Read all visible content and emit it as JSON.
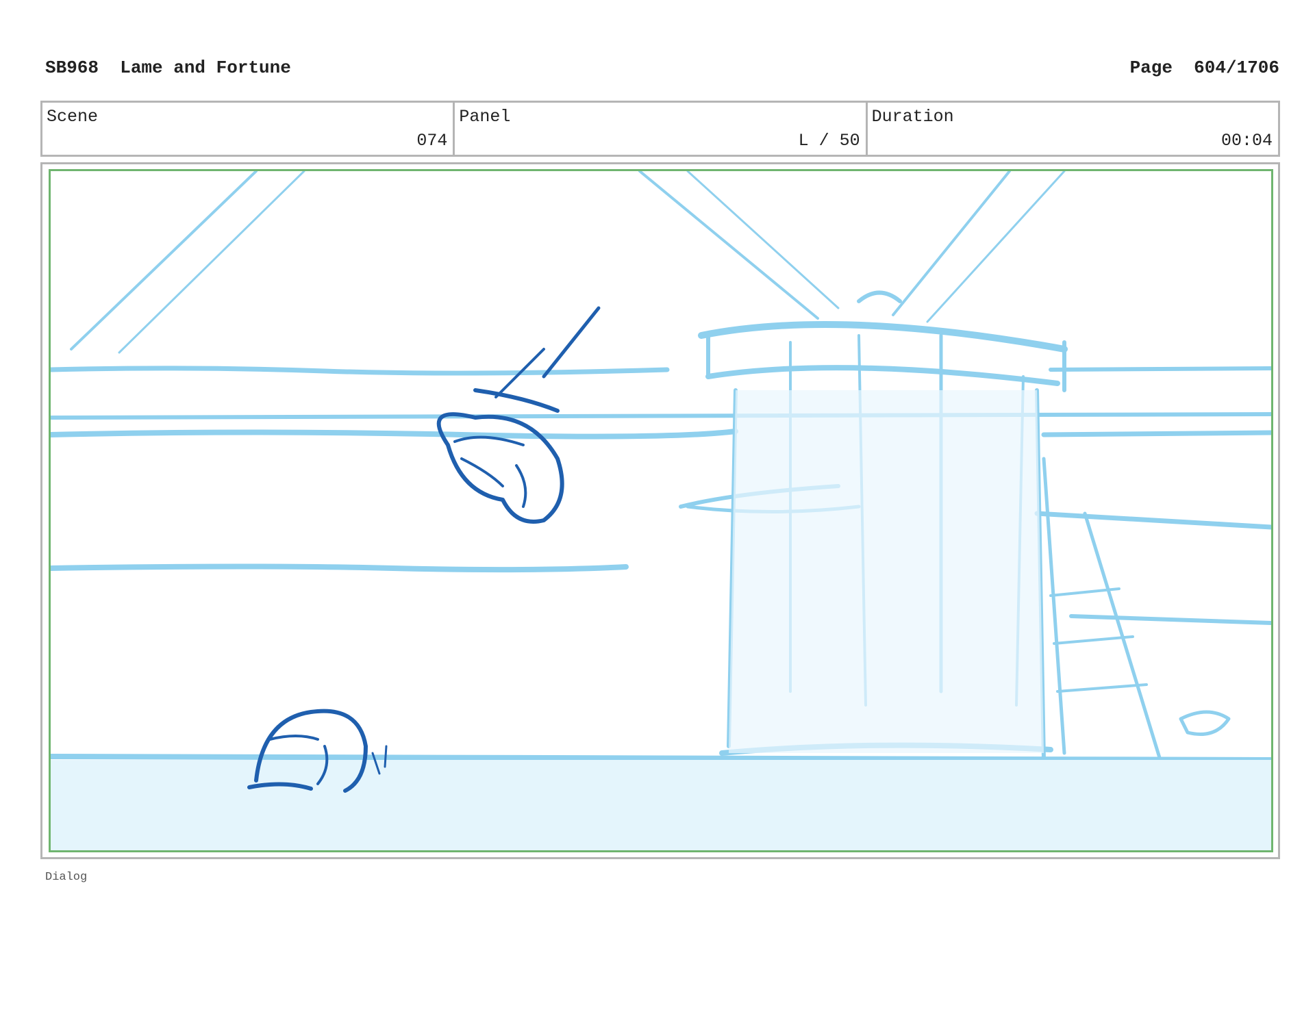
{
  "header": {
    "title": "SB968  Lame and Fortune",
    "page": "Page  604/1706"
  },
  "info": {
    "scene_label": "Scene",
    "scene_value": "074",
    "panel_label": "Panel",
    "panel_value": "L / 50",
    "duration_label": "Duration",
    "duration_value": "00:04"
  },
  "footer": {
    "dialog_label": "Dialog"
  },
  "colors": {
    "background_sketch": "#8fd0ee",
    "character_ink": "#1f5fae",
    "frame_border": "#6fb56f",
    "table_border": "#b5b5b5"
  }
}
